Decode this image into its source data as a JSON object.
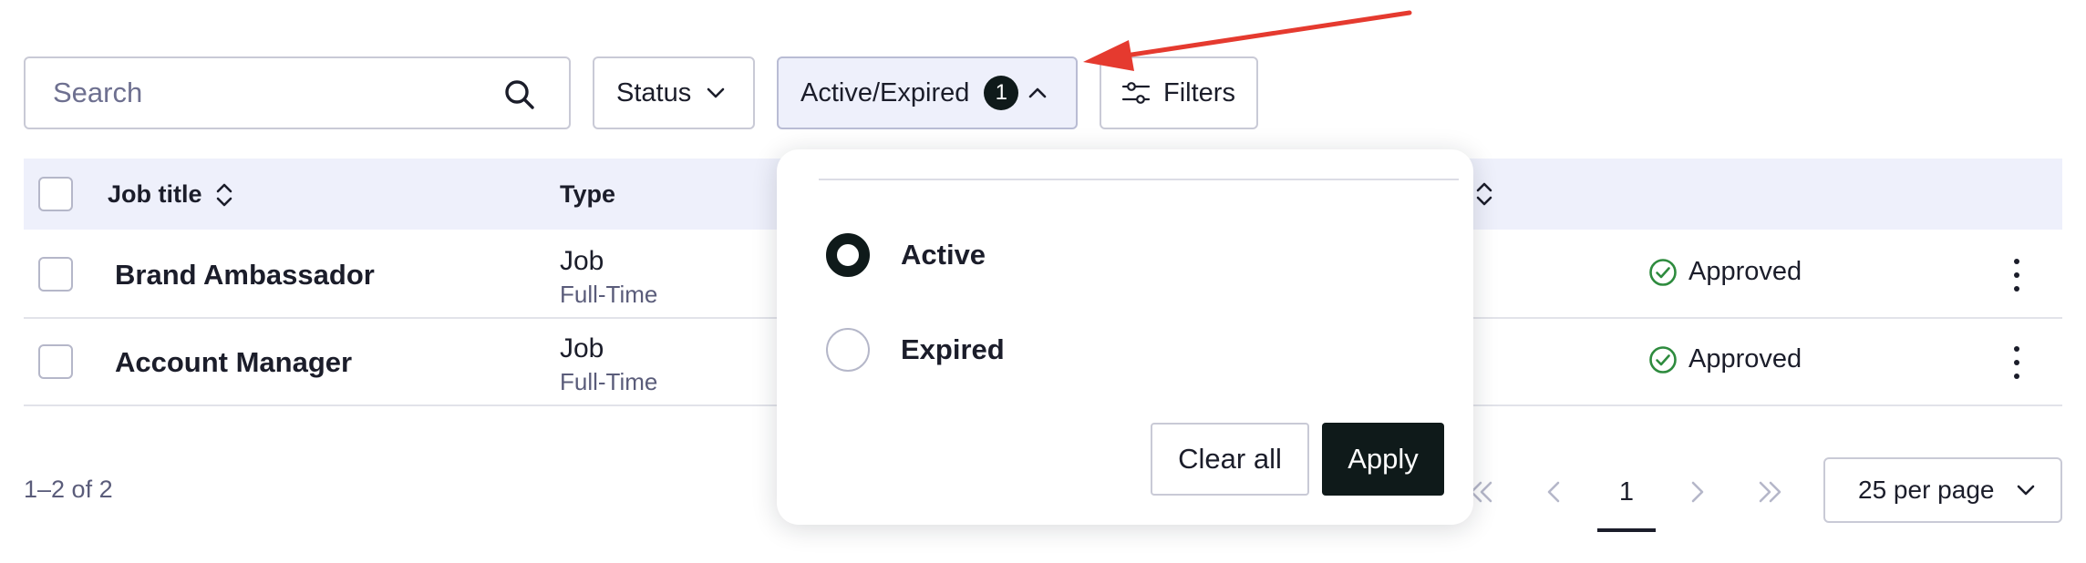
{
  "search": {
    "placeholder": "Search"
  },
  "filters": {
    "status_label": "Status",
    "active_expired_label": "Active/Expired",
    "active_expired_count": "1",
    "filters_label": "Filters"
  },
  "table": {
    "headers": [
      "Job title",
      "Type"
    ],
    "rows": [
      {
        "title": "Brand Ambassador",
        "type": "Job",
        "subtype": "Full-Time",
        "status": "Approved"
      },
      {
        "title": "Account Manager",
        "type": "Job",
        "subtype": "Full-Time",
        "status": "Approved"
      }
    ]
  },
  "pagination": {
    "range_text": "1–2 of 2",
    "current_page": "1",
    "per_page": "25 per page"
  },
  "popover": {
    "options": [
      {
        "label": "Active",
        "selected": true
      },
      {
        "label": "Expired",
        "selected": false
      }
    ],
    "clear_label": "Clear all",
    "apply_label": "Apply"
  },
  "colors": {
    "accent_dark": "#0f1a1a",
    "status_green": "#2e8b3e",
    "annotation_red": "#e53a2f",
    "header_bg": "#eef0fb"
  },
  "icons": [
    "search-icon",
    "chevron-down-icon",
    "chevron-up-icon",
    "sliders-icon",
    "sort-icon",
    "check-circle-icon",
    "kebab-icon",
    "double-chevron-left-icon",
    "chevron-left-icon",
    "chevron-right-icon",
    "double-chevron-right-icon",
    "red-arrow-annotation"
  ]
}
